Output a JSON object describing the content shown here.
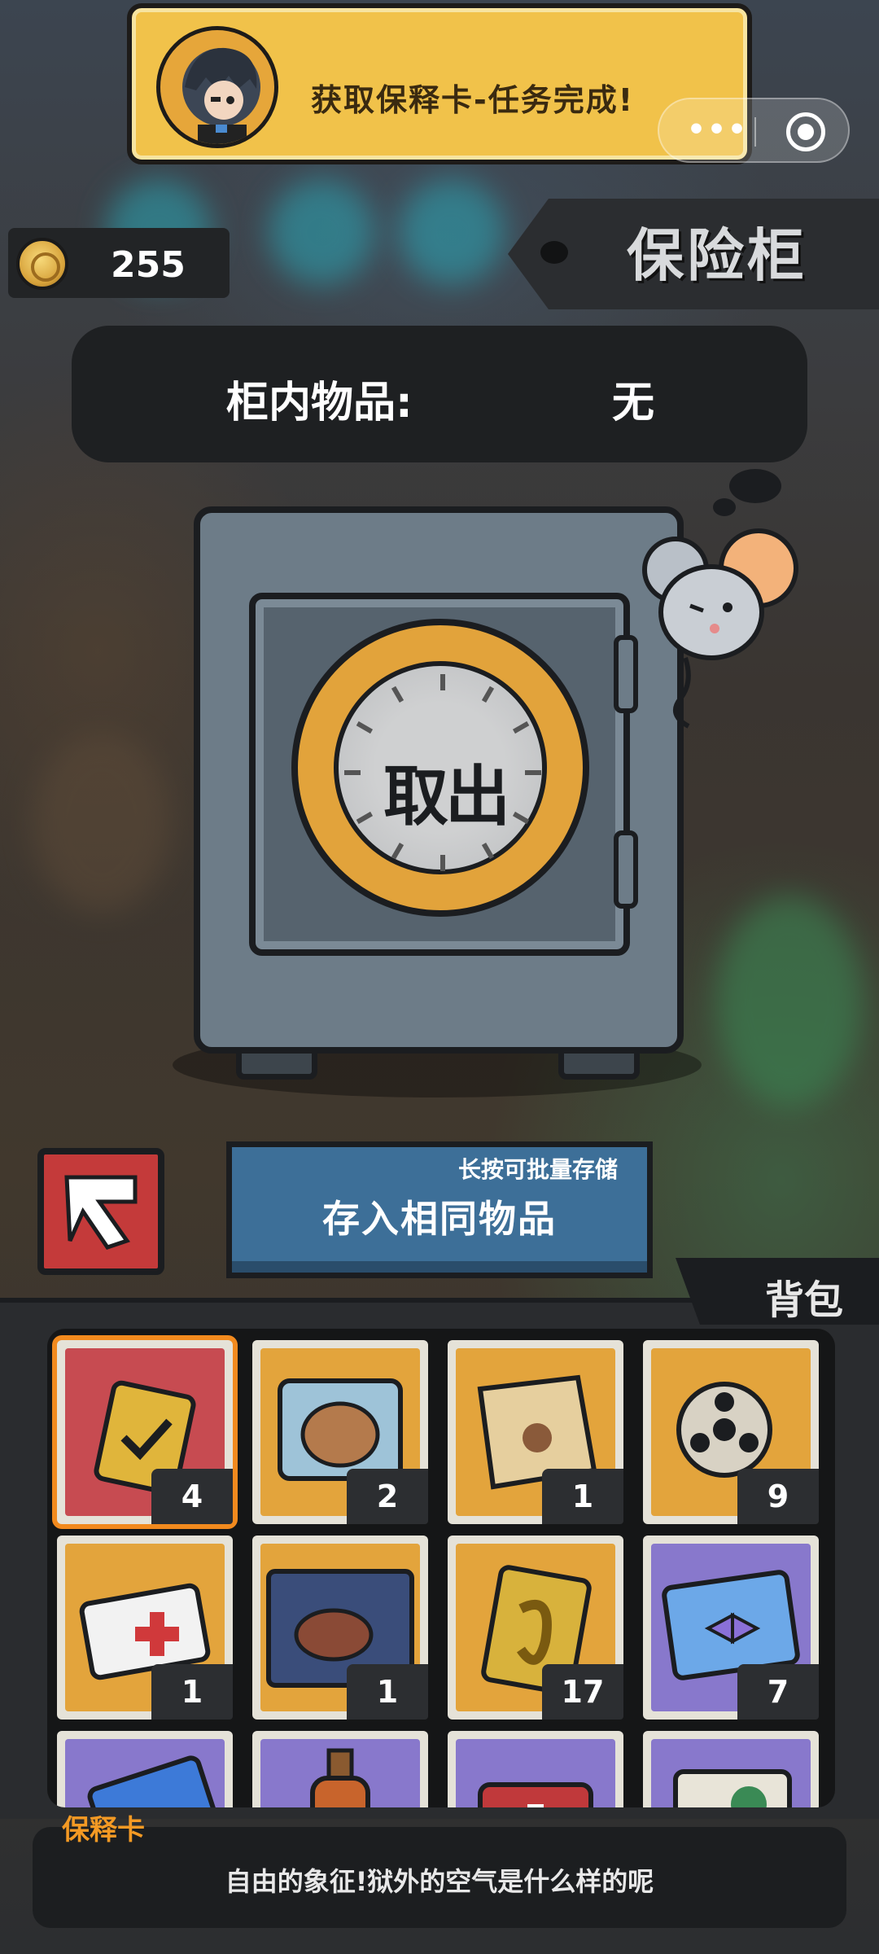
{
  "toast": {
    "message": "获取保释卡-任务完成!"
  },
  "coins": {
    "value": "255"
  },
  "header": {
    "title": "保险柜"
  },
  "safe": {
    "contents_label": "柜内物品:",
    "contents_value": "无",
    "dial_label": "取出"
  },
  "actions": {
    "store_hint": "长按可批量存储",
    "store_label": "存入相同物品"
  },
  "backpack": {
    "title": "背包",
    "selected_index": 0,
    "items": [
      {
        "count": "4",
        "icon": "bail-card-icon",
        "bg": "red"
      },
      {
        "count": "2",
        "icon": "capybara-pack-icon",
        "bg": "org"
      },
      {
        "count": "1",
        "icon": "treasure-map-icon",
        "bg": "org"
      },
      {
        "count": "9",
        "icon": "film-reel-icon",
        "bg": "org"
      },
      {
        "count": "1",
        "icon": "medical-card-icon",
        "bg": "org"
      },
      {
        "count": "1",
        "icon": "steak-pack-icon",
        "bg": "org"
      },
      {
        "count": "17",
        "icon": "gold-ring-icon",
        "bg": "org"
      },
      {
        "count": "7",
        "icon": "toy-ticket-icon",
        "bg": "pur"
      }
    ],
    "partial_row": [
      {
        "icon": "blue-card-icon",
        "bg": "pur"
      },
      {
        "icon": "bottle-icon",
        "bg": "pur"
      },
      {
        "icon": "first-aid-kit-icon",
        "bg": "pur"
      },
      {
        "icon": "green-pack-icon",
        "bg": "pur"
      }
    ]
  },
  "item_detail": {
    "name": "保释卡",
    "description": "自由的象征!狱外的空气是什么样的呢"
  },
  "colors": {
    "accent": "#f28a1e",
    "store_button": "#3d6f98",
    "safe_body": "#6d7c88"
  }
}
